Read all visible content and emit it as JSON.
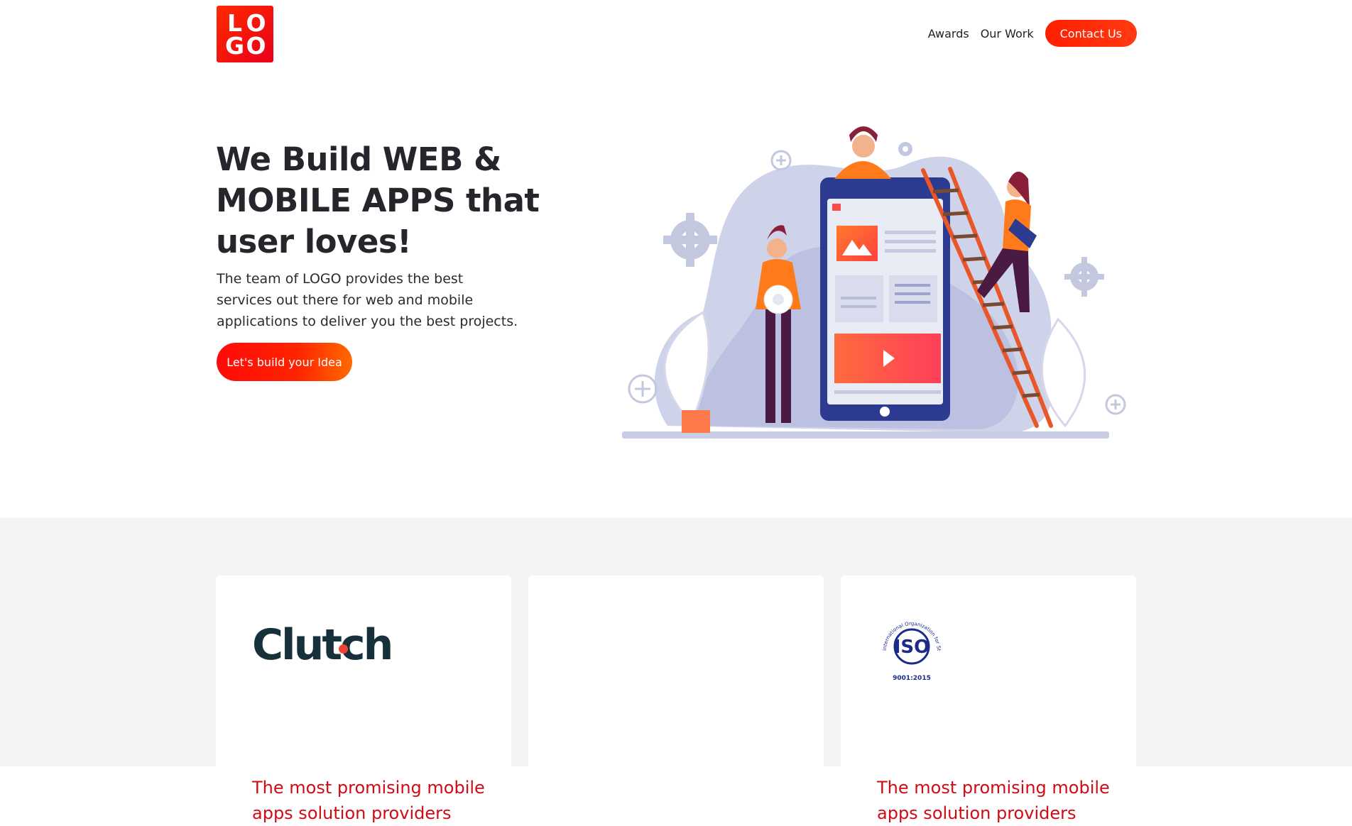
{
  "header": {
    "logo_top": "LO",
    "logo_bottom": "GO",
    "nav": [
      {
        "label": "Awards"
      },
      {
        "label": "Our Work"
      }
    ],
    "contact_label": "Contact Us"
  },
  "hero": {
    "title": "We Build WEB & MOBILE APPS that user loves!",
    "subtitle": "The team of LOGO provides the best services out there for web and mobile applications to deliver you the best projects.",
    "cta_label": "Let's build your Idea"
  },
  "awards": {
    "cards": [
      {
        "logo_text": "Clutch",
        "text": "The most promising mobile apps solution providers"
      },
      {
        "logo_text": "",
        "text": ""
      },
      {
        "logo_text": "ISO",
        "logo_caption": "International Organization for Standardization",
        "logo_number": "9001:2015",
        "text": "The most promising mobile apps solution providers"
      }
    ]
  },
  "colors": {
    "accent": "#ff1e00",
    "award_text": "#d10b15",
    "section_bg": "#f4f4f4"
  }
}
